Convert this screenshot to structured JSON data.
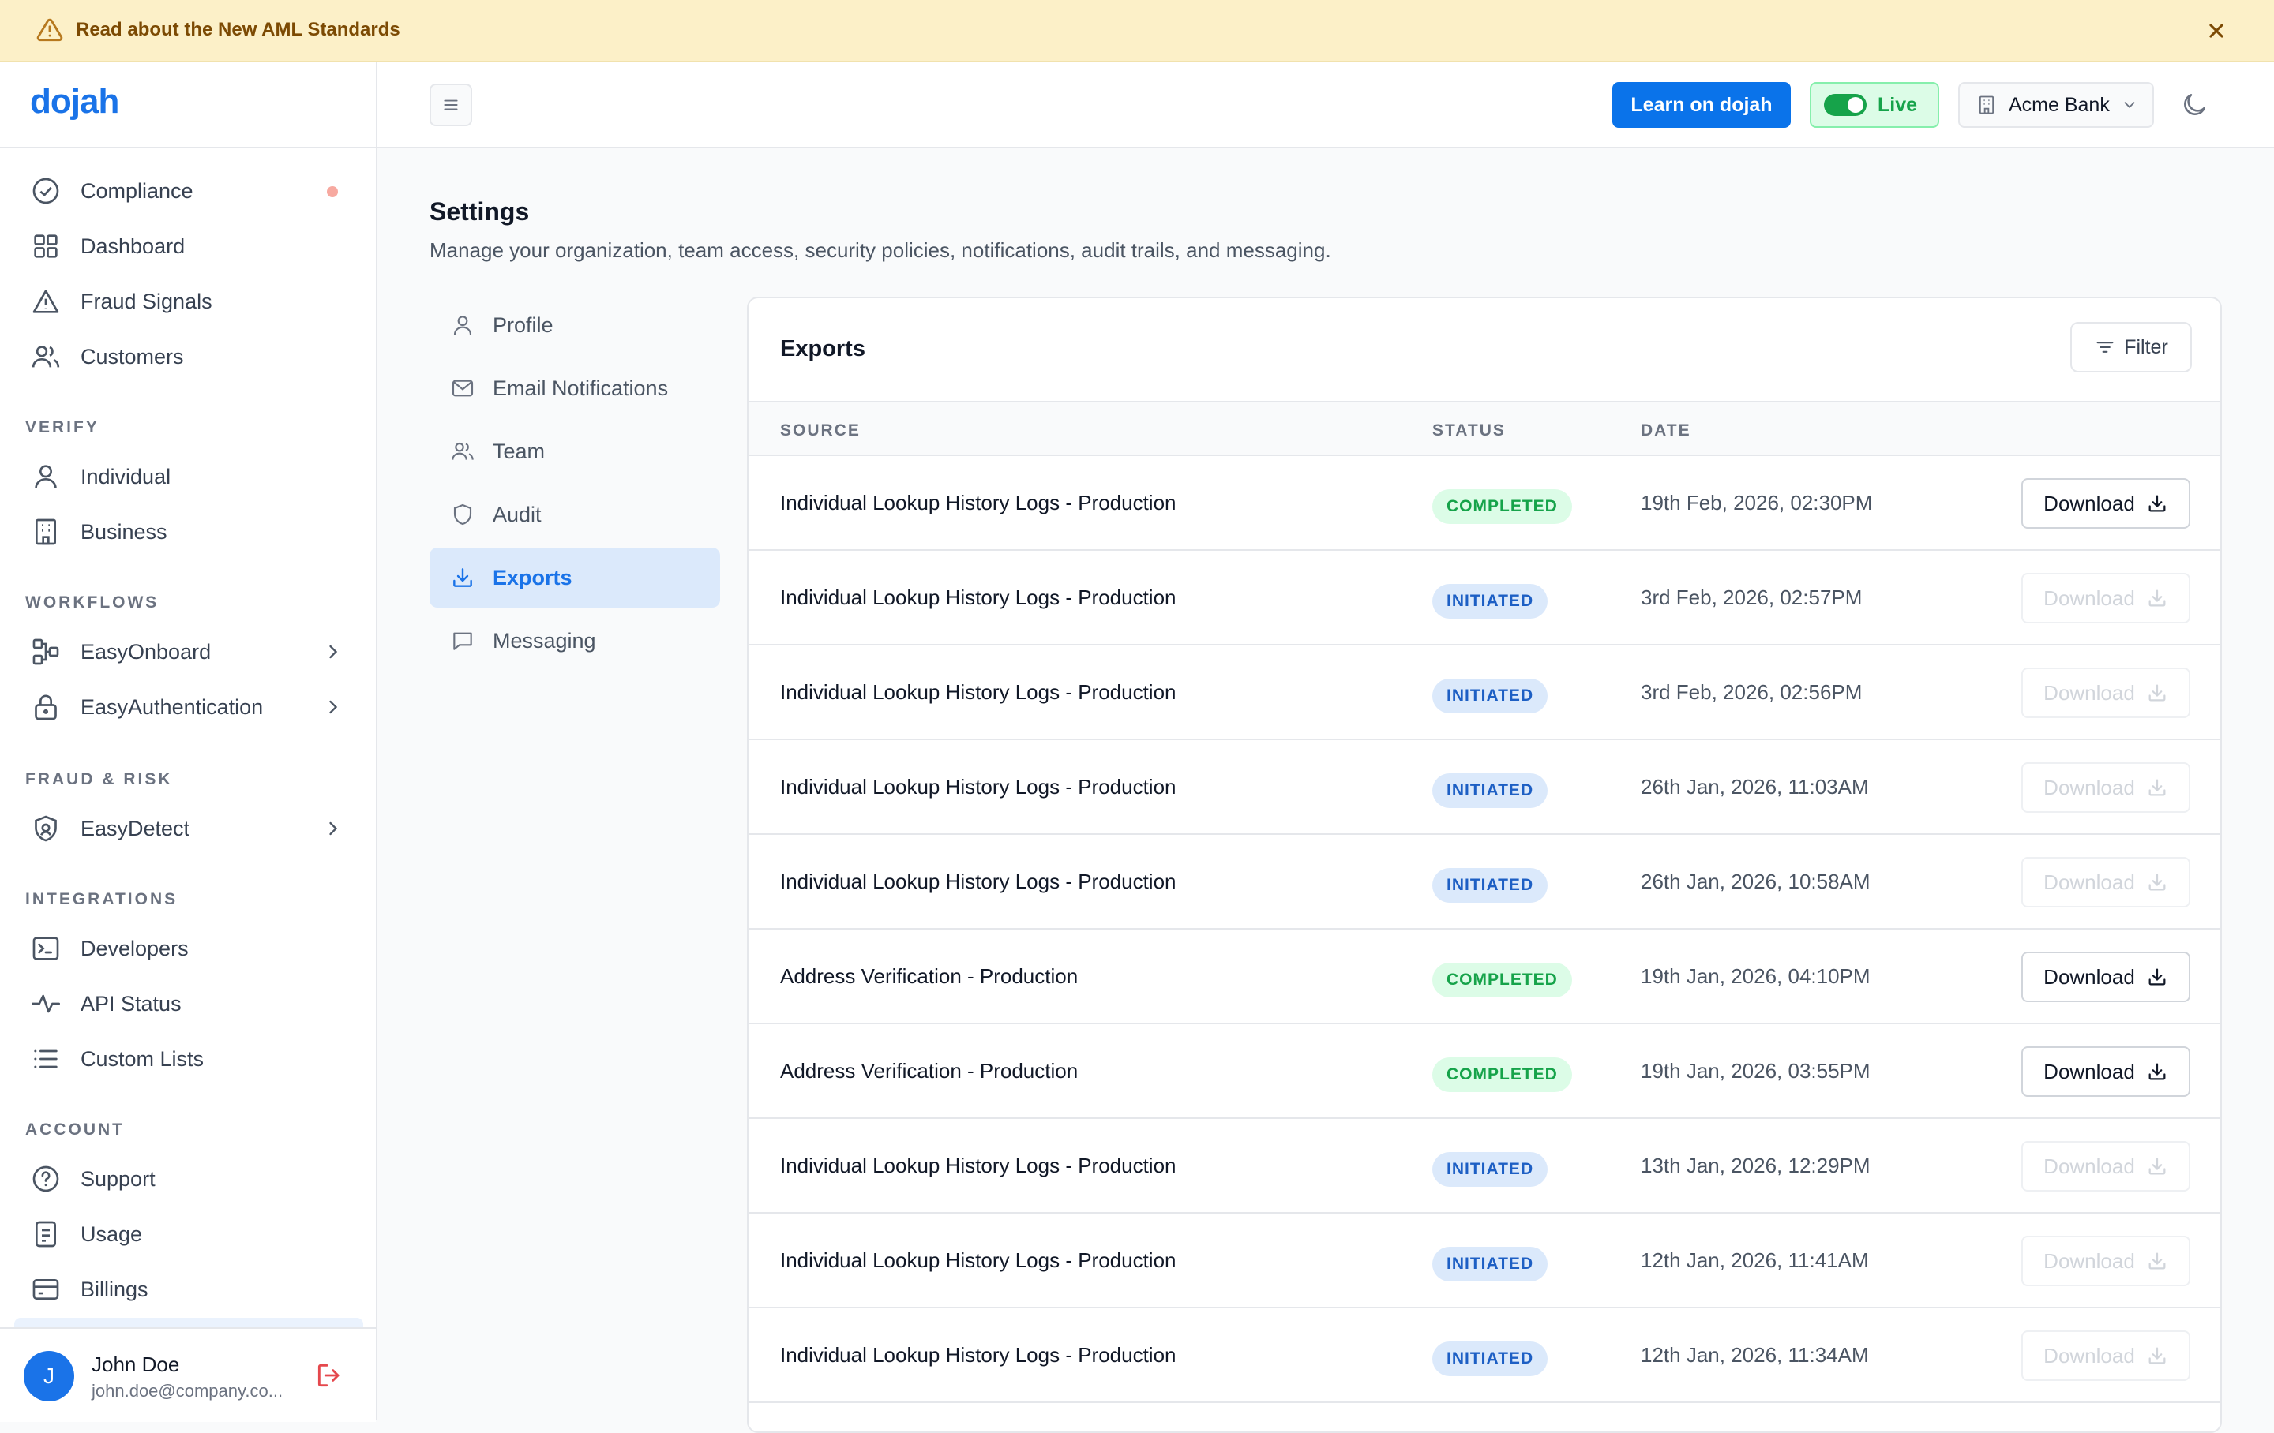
{
  "banner": {
    "text": "Read about the New AML Standards"
  },
  "logo": {
    "text": "dojah"
  },
  "sidebar": {
    "top_items": [
      {
        "label": "Compliance",
        "icon": "check-circle-icon"
      },
      {
        "label": "Dashboard",
        "icon": "grid-icon"
      },
      {
        "label": "Fraud Signals",
        "icon": "warning-icon"
      },
      {
        "label": "Customers",
        "icon": "users-icon"
      }
    ],
    "sections": {
      "verify": "VERIFY",
      "workflows": "WORKFLOWS",
      "fraud": "FRAUD & RISK",
      "integrations": "INTEGRATIONS",
      "account": "ACCOUNT"
    },
    "verify_items": [
      {
        "label": "Individual",
        "icon": "user-icon"
      },
      {
        "label": "Business",
        "icon": "building-icon"
      }
    ],
    "workflow_items": [
      {
        "label": "EasyOnboard",
        "icon": "workflow-icon"
      },
      {
        "label": "EasyAuthentication",
        "icon": "lock-icon"
      }
    ],
    "fraud_items": [
      {
        "label": "EasyDetect",
        "icon": "shield-icon"
      }
    ],
    "integration_items": [
      {
        "label": "Developers",
        "icon": "terminal-icon"
      },
      {
        "label": "API Status",
        "icon": "activity-icon"
      },
      {
        "label": "Custom Lists",
        "icon": "list-icon"
      }
    ],
    "account_items": [
      {
        "label": "Support",
        "icon": "help-circle-icon"
      },
      {
        "label": "Usage",
        "icon": "document-icon"
      },
      {
        "label": "Billings",
        "icon": "credit-card-icon"
      }
    ],
    "user": {
      "initial": "J",
      "name": "John Doe",
      "email": "john.doe@company.co..."
    }
  },
  "header": {
    "learn_label": "Learn on dojah",
    "live_label": "Live",
    "org_label": "Acme Bank"
  },
  "page": {
    "title": "Settings",
    "subtitle": "Manage your organization, team access, security policies, notifications, audit trails, and messaging."
  },
  "settings_nav": [
    {
      "label": "Profile",
      "icon": "user-icon",
      "active": false
    },
    {
      "label": "Email Notifications",
      "icon": "mail-icon",
      "active": false
    },
    {
      "label": "Team",
      "icon": "users-icon",
      "active": false
    },
    {
      "label": "Audit",
      "icon": "shield-icon",
      "active": false
    },
    {
      "label": "Exports",
      "icon": "download-icon",
      "active": true
    },
    {
      "label": "Messaging",
      "icon": "message-icon",
      "active": false
    }
  ],
  "exports": {
    "title": "Exports",
    "filter_label": "Filter",
    "columns": {
      "source": "SOURCE",
      "status": "STATUS",
      "date": "DATE"
    },
    "download_label": "Download",
    "rows": [
      {
        "source": "Individual Lookup History Logs - Production",
        "status": "COMPLETED",
        "date": "19th Feb, 2026, 02:30PM"
      },
      {
        "source": "Individual Lookup History Logs - Production",
        "status": "INITIATED",
        "date": "3rd Feb, 2026, 02:57PM"
      },
      {
        "source": "Individual Lookup History Logs - Production",
        "status": "INITIATED",
        "date": "3rd Feb, 2026, 02:56PM"
      },
      {
        "source": "Individual Lookup History Logs - Production",
        "status": "INITIATED",
        "date": "26th Jan, 2026, 11:03AM"
      },
      {
        "source": "Individual Lookup History Logs - Production",
        "status": "INITIATED",
        "date": "26th Jan, 2026, 10:58AM"
      },
      {
        "source": "Address Verification - Production",
        "status": "COMPLETED",
        "date": "19th Jan, 2026, 04:10PM"
      },
      {
        "source": "Address Verification - Production",
        "status": "COMPLETED",
        "date": "19th Jan, 2026, 03:55PM"
      },
      {
        "source": "Individual Lookup History Logs - Production",
        "status": "INITIATED",
        "date": "13th Jan, 2026, 12:29PM"
      },
      {
        "source": "Individual Lookup History Logs - Production",
        "status": "INITIATED",
        "date": "12th Jan, 2026, 11:41AM"
      },
      {
        "source": "Individual Lookup History Logs - Production",
        "status": "INITIATED",
        "date": "12th Jan, 2026, 11:34AM"
      }
    ]
  },
  "colors": {
    "accent": "#1a73e8",
    "banner_bg": "#fcf0c8",
    "completed": "#16a34a",
    "initiated": "#1d5fc4"
  }
}
